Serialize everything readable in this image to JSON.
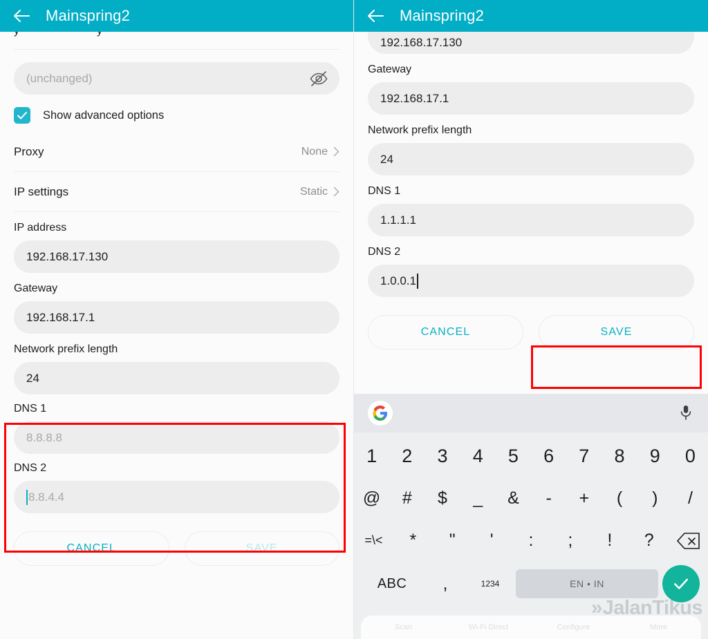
{
  "app": {
    "title": "Mainspring2",
    "header_color": "#02adc6",
    "accent_color": "#06b0c4",
    "highlight_color": "#ff0000"
  },
  "left_panel": {
    "clipped_top": {
      "a": "y",
      "b": "y"
    },
    "password_field": {
      "value": "",
      "placeholder": "(unchanged)"
    },
    "eye_icon": "eye-off-icon",
    "advanced_checkbox": {
      "label": "Show advanced options",
      "checked": true
    },
    "rows": [
      {
        "label": "Proxy",
        "value": "None"
      },
      {
        "label": "IP settings",
        "value": "Static"
      }
    ],
    "fields": [
      {
        "label": "IP address",
        "value": "192.168.17.130",
        "placeholder": ""
      },
      {
        "label": "Gateway",
        "value": "192.168.17.1",
        "placeholder": ""
      },
      {
        "label": "Network prefix length",
        "value": "24",
        "placeholder": ""
      },
      {
        "label": "DNS 1",
        "value": "",
        "placeholder": "8.8.8.8"
      },
      {
        "label": "DNS 2",
        "value": "",
        "placeholder": "8.8.4.4"
      }
    ],
    "buttons": {
      "cancel": "CANCEL",
      "save": "SAVE",
      "save_enabled": false
    }
  },
  "right_panel": {
    "top_field_value": "192.168.17.130",
    "fields": [
      {
        "label": "Gateway",
        "value": "192.168.17.1"
      },
      {
        "label": "Network prefix length",
        "value": "24"
      },
      {
        "label": "DNS 1",
        "value": "1.1.1.1"
      },
      {
        "label": "DNS 2",
        "value": "1.0.0.1"
      }
    ],
    "buttons": {
      "cancel": "CANCEL",
      "save": "SAVE",
      "save_enabled": true
    }
  },
  "keyboard": {
    "suggestion_bar": {
      "left_icon": "google-logo-icon",
      "right_icon": "microphone-icon"
    },
    "row_numbers": [
      "1",
      "2",
      "3",
      "4",
      "5",
      "6",
      "7",
      "8",
      "9",
      "0"
    ],
    "row_symbols": [
      "@",
      "#",
      "$",
      "_",
      "&",
      "-",
      "+",
      "(",
      ")",
      "/"
    ],
    "row_symbols2": [
      "=\\<",
      "*",
      "\"",
      "'",
      ":",
      ";",
      "!",
      "?"
    ],
    "backspace_icon": "backspace-icon",
    "bottom": {
      "abc": "ABC",
      "comma": ",",
      "numeric": "1234",
      "space_label": "EN • IN",
      "enter_icon": "check-icon",
      "enter_color": "#12b49b"
    }
  },
  "ghost_bar": [
    "Scan",
    "Wi-Fi Direct",
    "Configure",
    "More"
  ],
  "watermark": {
    "text": "JalanTikus",
    "chevrons": "»"
  }
}
